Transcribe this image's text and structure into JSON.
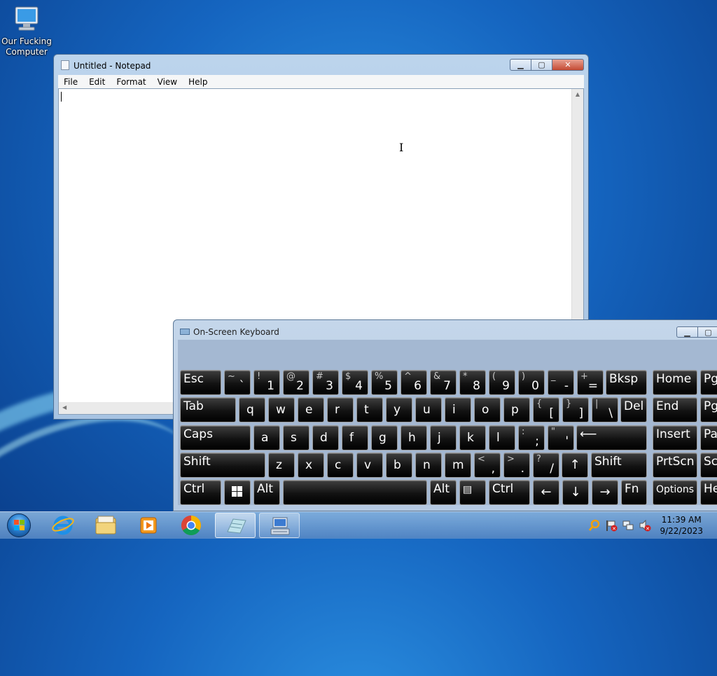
{
  "desktop": {
    "icons": [
      {
        "label": "Our Fucking Computer",
        "icon": "computer-icon"
      }
    ]
  },
  "notepad": {
    "title": "Untitled - Notepad",
    "menu": [
      "File",
      "Edit",
      "Format",
      "View",
      "Help"
    ],
    "content": ""
  },
  "osk": {
    "title": "On-Screen Keyboard",
    "rows": {
      "r1_digits": [
        {
          "shift": "~",
          "main": "`"
        },
        {
          "shift": "!",
          "main": "1"
        },
        {
          "shift": "@",
          "main": "2"
        },
        {
          "shift": "#",
          "main": "3"
        },
        {
          "shift": "$",
          "main": "4"
        },
        {
          "shift": "%",
          "main": "5"
        },
        {
          "shift": "^",
          "main": "6"
        },
        {
          "shift": "&",
          "main": "7"
        },
        {
          "shift": "*",
          "main": "8"
        },
        {
          "shift": "(",
          "main": "9"
        },
        {
          "shift": ")",
          "main": "0"
        },
        {
          "shift": "_",
          "main": "-"
        },
        {
          "shift": "+",
          "main": "="
        }
      ],
      "r2_letters": [
        "q",
        "w",
        "e",
        "r",
        "t",
        "y",
        "u",
        "i",
        "o",
        "p"
      ],
      "r2_brackets": [
        {
          "shift": "{",
          "main": "["
        },
        {
          "shift": "}",
          "main": "]"
        },
        {
          "shift": "|",
          "main": "\\"
        }
      ],
      "r3_letters": [
        "a",
        "s",
        "d",
        "f",
        "g",
        "h",
        "j",
        "k",
        "l"
      ],
      "r3_punct": [
        {
          "shift": ":",
          "main": ";"
        },
        {
          "shift": "\"",
          "main": "'"
        }
      ],
      "r4_letters": [
        "z",
        "x",
        "c",
        "v",
        "b",
        "n",
        "m"
      ],
      "r4_punct": [
        {
          "shift": "<",
          "main": ","
        },
        {
          "shift": ">",
          "main": "."
        },
        {
          "shift": "?",
          "main": "/"
        }
      ]
    },
    "labels": {
      "esc": "Esc",
      "bksp": "Bksp",
      "home": "Home",
      "pgup": "Pg",
      "tab": "Tab",
      "del": "Del",
      "end": "End",
      "pgdn": "Pg",
      "caps": "Caps",
      "insert": "Insert",
      "pause": "Pa",
      "shift_l": "Shift",
      "shift_r": "Shift",
      "prtscn": "PrtScn",
      "scroll": "Sc",
      "ctrl_l": "Ctrl",
      "alt_l": "Alt",
      "alt_r": "Alt",
      "ctrl_r": "Ctrl",
      "fn": "Fn",
      "options": "Options",
      "help": "He",
      "up": "↑",
      "left": "←",
      "down": "↓",
      "right": "→",
      "enter": "⟵"
    }
  },
  "taskbar": {
    "pinned": [
      {
        "name": "internet-explorer",
        "icon": "ie-icon"
      },
      {
        "name": "windows-explorer",
        "icon": "folder-icon"
      },
      {
        "name": "media-player",
        "icon": "media-player-icon"
      },
      {
        "name": "chrome",
        "icon": "chrome-icon"
      },
      {
        "name": "notepad",
        "icon": "notepad-icon"
      },
      {
        "name": "on-screen-keyboard",
        "icon": "keyboard-icon"
      }
    ],
    "clock": {
      "time": "11:39 AM",
      "date": "9/22/2023"
    }
  },
  "colors": {
    "key_bg": "#000000",
    "key_text": "#ffffff",
    "taskbar": "#6f9fd6",
    "desktop": "#1565c0"
  }
}
